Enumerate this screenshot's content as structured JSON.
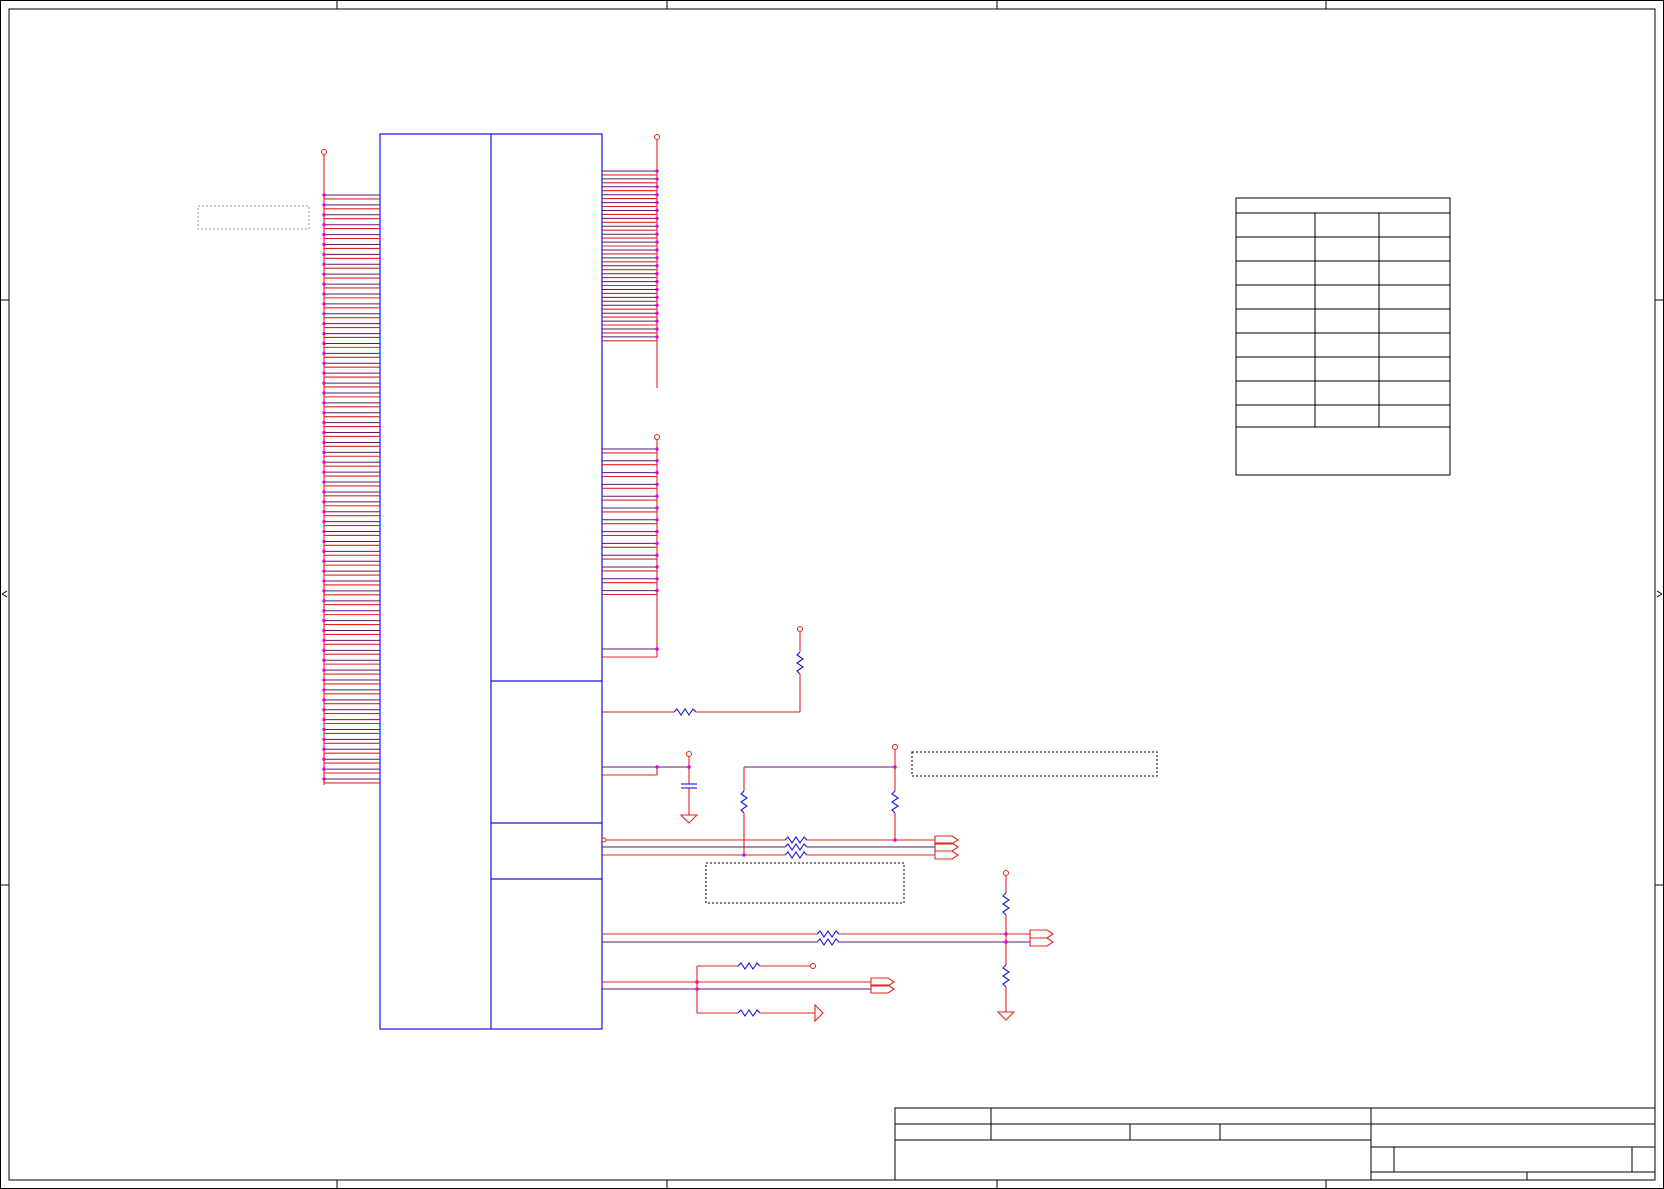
{
  "schematic": {
    "line_colors": {
      "wire": "#e0241b",
      "component_body": "#1515e0",
      "junction": "#e600e6",
      "frame": "#000000",
      "note_box": "#000000"
    },
    "main_part": {
      "sections": 4,
      "left_pin_count": 60,
      "right_pin_groups": [
        22,
        13
      ]
    },
    "table": {
      "columns": 3,
      "rows": 8
    },
    "title_block": {
      "text": ""
    },
    "icons": [
      "resistor-icon",
      "capacitor-icon",
      "ground-icon",
      "power-pin-icon",
      "offpage-connector-icon"
    ]
  }
}
